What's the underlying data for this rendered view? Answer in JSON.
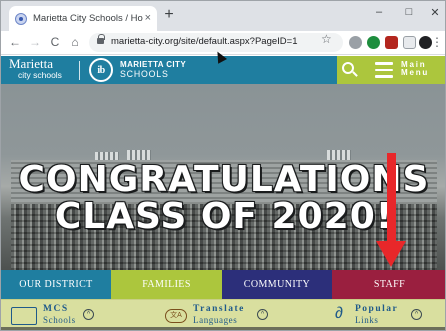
{
  "browser": {
    "tab_title": "Marietta City Schools / Homepa",
    "tab_close": "×",
    "new_tab": "+",
    "minimize": "–",
    "maximize": "□",
    "close": "✕",
    "back": "←",
    "forward": "→",
    "reload": "C",
    "home": "⌂",
    "url": "marietta-city.org/site/default.aspx?PageID=1",
    "star": "☆",
    "more": "⋮"
  },
  "site": {
    "logo_line1": "Marietta",
    "logo_line2": "city schools",
    "seal": "ib",
    "name_line1": "MARIETTA CITY",
    "name_line2": "SCHOOLS",
    "menu_line1": "Main",
    "menu_line2": "Menu"
  },
  "hero": {
    "line1": "CONGRATULATIONS",
    "line2": "CLASS OF 2020!"
  },
  "nav": {
    "district": "OUR DISTRICT",
    "families": "FAMILIES",
    "community": "COMMUNITY",
    "staff": "STAFF"
  },
  "quick_links": {
    "mcs_top": "MCS",
    "mcs_bottom": "Schools",
    "translate_top": "Translate",
    "translate_bottom": "Languages",
    "popular_top": "Popular",
    "popular_bottom": "Links"
  },
  "colors": {
    "teal": "#1f7ea0",
    "lime": "#acc63d",
    "navy": "#2c2f7a",
    "maroon": "#9a1f3f",
    "arrow": "#e8272a"
  }
}
